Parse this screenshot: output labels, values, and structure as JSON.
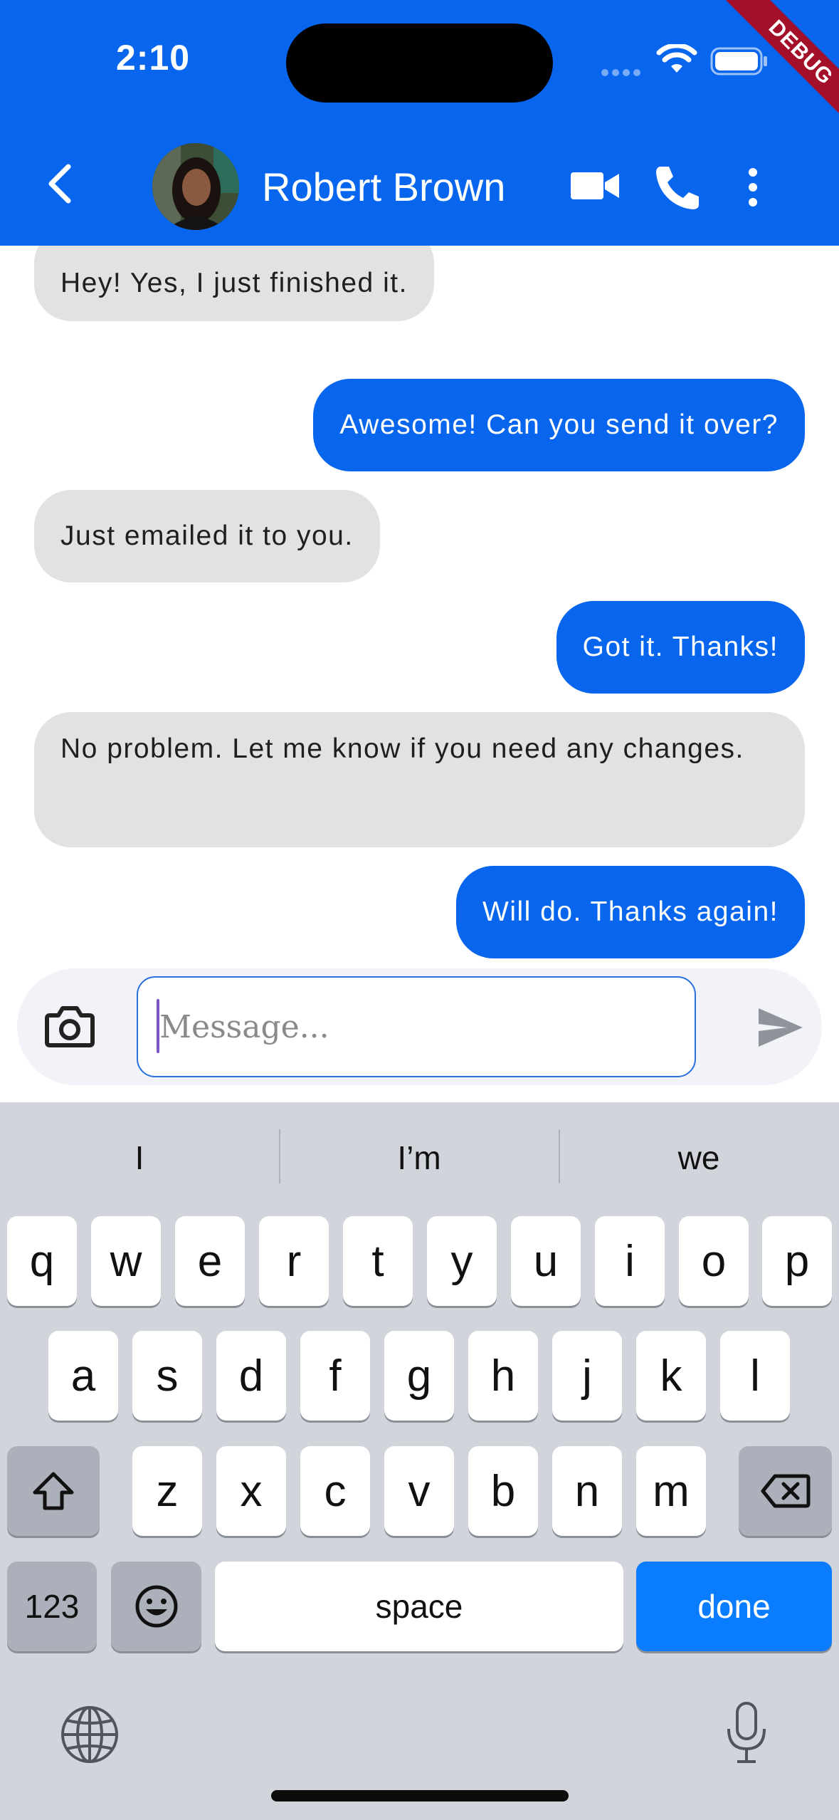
{
  "status_bar": {
    "time": "2:10",
    "debug_label": "DEBUG"
  },
  "header": {
    "contact_name": "Robert Brown",
    "icons": {
      "back": "back-chevron-icon",
      "video": "video-camera-icon",
      "call": "phone-icon",
      "more": "more-vertical-icon"
    }
  },
  "messages": [
    {
      "direction": "incoming",
      "text": "Hey! Yes, I just finished it."
    },
    {
      "direction": "outgoing",
      "text": "Awesome! Can you send it over?"
    },
    {
      "direction": "incoming",
      "text": "Just emailed it to you."
    },
    {
      "direction": "outgoing",
      "text": "Got it. Thanks!"
    },
    {
      "direction": "incoming",
      "text": "No problem. Let me know if you need any changes."
    },
    {
      "direction": "outgoing",
      "text": "Will do. Thanks again!"
    }
  ],
  "composer": {
    "placeholder": "Message...",
    "value": ""
  },
  "keyboard": {
    "suggestions": [
      "I",
      "I’m",
      "we"
    ],
    "row1": [
      "q",
      "w",
      "e",
      "r",
      "t",
      "y",
      "u",
      "i",
      "o",
      "p"
    ],
    "row2": [
      "a",
      "s",
      "d",
      "f",
      "g",
      "h",
      "j",
      "k",
      "l"
    ],
    "row3": [
      "z",
      "x",
      "c",
      "v",
      "b",
      "n",
      "m"
    ],
    "numbers_label": "123",
    "space_label": "space",
    "done_label": "done"
  },
  "colors": {
    "brand_blue": "#0866ee",
    "incoming_bubble": "#e2e2e2",
    "keyboard_bg": "#d1d4da",
    "done_key": "#0a7cff"
  }
}
